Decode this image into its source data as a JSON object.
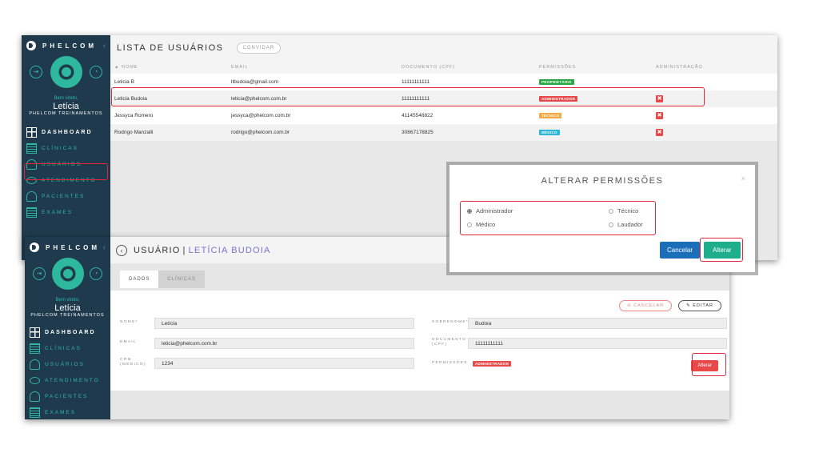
{
  "brand": {
    "name": "PHELCOM",
    "collapse_icon": "chevron-left-icon"
  },
  "profile": {
    "welcome": "Bem vindo,",
    "user_name": "Letícia",
    "company": "PHELCOM TREINAMENTOS"
  },
  "nav": {
    "dashboard": "DASHBOARD",
    "clinics": "CLÍNICAS",
    "users": "USUÁRIOS",
    "attendance": "ATENDIMENTO",
    "patients": "PACIENTES",
    "exams": "EXAMES"
  },
  "users_list": {
    "title": "LISTA DE USUÁRIOS",
    "invite_label": "CONVIDAR",
    "columns": [
      "▲ NOME",
      "EMAIL",
      "DOCUMENTO (CPF)",
      "PERMISSÕES",
      "ADMINISTRAÇÃO"
    ],
    "rows": [
      {
        "name": "Leticia B",
        "email": "ltbudoia@gmail.com",
        "cpf": "11111111111",
        "permission": "PROPRIETÁRIO",
        "color": "#27a844",
        "delete": ""
      },
      {
        "name": "Leticia Budoia",
        "email": "leticia@phelcom.com.br",
        "cpf": "11111111111",
        "permission": "ADMINISTRADOR",
        "color": "#e84a4a",
        "delete": "✖"
      },
      {
        "name": "Jessyca Romero",
        "email": "jessyca@phelcom.com.br",
        "cpf": "41145548822",
        "permission": "TÉCNICO",
        "color": "#f5a742",
        "delete": "✖"
      },
      {
        "name": "Rodrigo Manzalli",
        "email": "rodrigo@phelcom.com.br",
        "cpf": "30867178825",
        "permission": "MÉDICO",
        "color": "#2bb6d8",
        "delete": "✖"
      }
    ]
  },
  "user_detail": {
    "title": "USUÁRIO",
    "separator": "|",
    "name": "LETÍCIA BUDOIA",
    "tabs": [
      "DADOS",
      "CLÍNICAS"
    ],
    "cancel_label": "CANCELAR",
    "edit_label": "EDITAR",
    "fields": {
      "nome_label": "NOME*",
      "nome_value": "Letícia",
      "email_label": "EMAIL",
      "email_value": "leticia@phelcom.com.br",
      "crm_label": "CRM (MÉDICO)",
      "crm_value": "1234",
      "sobrenome_label": "SOBRENOME*",
      "sobrenome_value": "Budoia",
      "documento_label": "DOCUMENTO (CPF)",
      "documento_value": "11111111111",
      "permissoes_label": "PERMISSÕES",
      "permissoes_value": "ADMINISTRADOR"
    },
    "alter_label": "Alterar"
  },
  "modal": {
    "title": "ALTERAR PERMISSÕES",
    "close": "×",
    "options": [
      "Administrador",
      "Médico",
      "Técnico",
      "Laudador"
    ],
    "selected": "Administrador",
    "cancel_label": "Cancelar",
    "confirm_label": "Alterar"
  },
  "colors": {
    "sidebar": "#1f3a4d",
    "accent": "#2fb8a0",
    "danger": "#e84a4a",
    "primary": "#1a6fb8",
    "success": "#1fae8c",
    "highlight": "#e0283c"
  }
}
